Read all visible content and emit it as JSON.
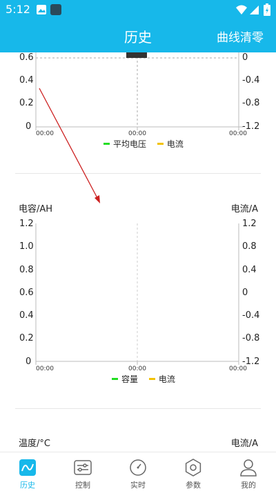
{
  "status_bar": {
    "time": "5:12"
  },
  "app_bar": {
    "title": "历史",
    "action": "曲线清零"
  },
  "charts": [
    {
      "left_ticks": [
        "0.6",
        "0.4",
        "0.2",
        "0"
      ],
      "right_ticks": [
        "0",
        "-0.4",
        "-0.8",
        "-1.2"
      ],
      "x_ticks": [
        "00:00",
        "00:00",
        "00:00"
      ],
      "legend": [
        {
          "label": "平均电压",
          "color": "#22dd22"
        },
        {
          "label": "电流",
          "color": "#f2c200"
        }
      ]
    },
    {
      "left_title": "电容/AH",
      "right_title": "电流/A",
      "left_ticks": [
        "1.2",
        "1.0",
        "0.8",
        "0.6",
        "0.4",
        "0.2",
        "0"
      ],
      "right_ticks": [
        "1.2",
        "0.8",
        "0.4",
        "0",
        "-0.4",
        "-0.8",
        "-1.2"
      ],
      "x_ticks": [
        "00:00",
        "00:00",
        "00:00"
      ],
      "legend": [
        {
          "label": "容量",
          "color": "#22dd22"
        },
        {
          "label": "电流",
          "color": "#f2c200"
        }
      ]
    },
    {
      "left_title": "温度/°C",
      "right_title": "电流/A"
    }
  ],
  "tabs": [
    {
      "label": "历史",
      "icon": "wave-chart-icon",
      "active": true
    },
    {
      "label": "控制",
      "icon": "sliders-icon",
      "active": false
    },
    {
      "label": "实时",
      "icon": "gauge-icon",
      "active": false
    },
    {
      "label": "参数",
      "icon": "hexagon-nut-icon",
      "active": false
    },
    {
      "label": "我的",
      "icon": "user-icon",
      "active": false
    }
  ],
  "colors": {
    "primary": "#17b8ea",
    "annotation_arrow": "#cc1f1f",
    "marker": "#333333"
  }
}
